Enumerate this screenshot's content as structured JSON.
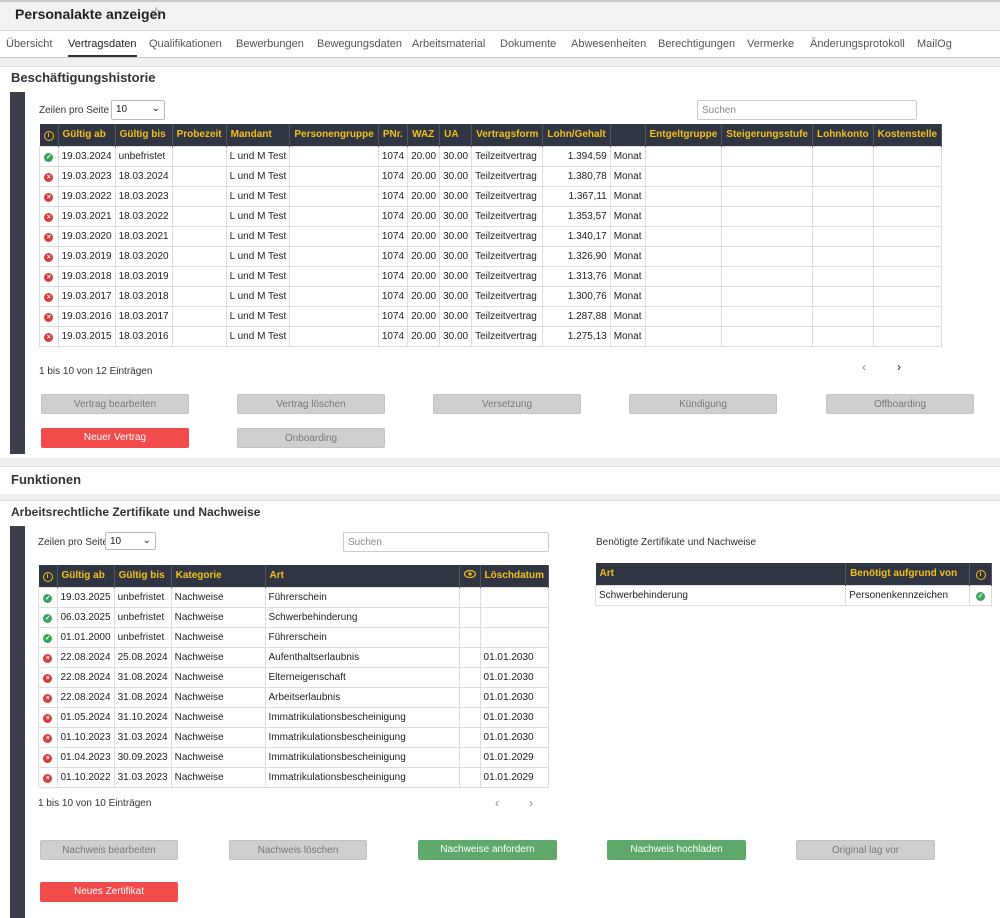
{
  "header": {
    "title": "Personalakte anzeigen"
  },
  "tabs": [
    "Übersicht",
    "Vertragsdaten",
    "Qualifikationen",
    "Bewerbungen",
    "Bewegungsdaten",
    "Arbeitsmaterial",
    "Dokumente",
    "Abwesenheiten",
    "Berechtigungen",
    "Vermerke",
    "Änderungsprotokoll",
    "MailOg"
  ],
  "history": {
    "title": "Beschäftigungshistorie",
    "rows_label": "Zeilen pro Seite",
    "rows_value": "10",
    "search_placeholder": "Suchen",
    "columns": [
      "Gültig ab",
      "Gültig bis",
      "Probezeit",
      "Mandant",
      "Personengruppe",
      "PNr.",
      "WAZ",
      "UA",
      "Vertragsform",
      "Lohn/Gehalt",
      "",
      "Entgeltgruppe",
      "Steigerungsstufe",
      "Lohnkonto",
      "Kostenstelle"
    ],
    "rows": [
      {
        "status": "ok",
        "from": "19.03.2024",
        "to": "unbefristet",
        "probation": "",
        "client": "L und M Test",
        "group": "",
        "pnr": "1074",
        "waz": "20.00",
        "ua": "30.00",
        "form": "Teilzeitvertrag",
        "salary": "1.394,59",
        "unit": "Monat"
      },
      {
        "status": "no",
        "from": "19.03.2023",
        "to": "18.03.2024",
        "probation": "",
        "client": "L und M Test",
        "group": "",
        "pnr": "1074",
        "waz": "20.00",
        "ua": "30.00",
        "form": "Teilzeitvertrag",
        "salary": "1.380,78",
        "unit": "Monat"
      },
      {
        "status": "no",
        "from": "19.03.2022",
        "to": "18.03.2023",
        "probation": "",
        "client": "L und M Test",
        "group": "",
        "pnr": "1074",
        "waz": "20.00",
        "ua": "30.00",
        "form": "Teilzeitvertrag",
        "salary": "1.367,11",
        "unit": "Monat"
      },
      {
        "status": "no",
        "from": "19.03.2021",
        "to": "18.03.2022",
        "probation": "",
        "client": "L und M Test",
        "group": "",
        "pnr": "1074",
        "waz": "20.00",
        "ua": "30.00",
        "form": "Teilzeitvertrag",
        "salary": "1.353,57",
        "unit": "Monat"
      },
      {
        "status": "no",
        "from": "19.03.2020",
        "to": "18.03.2021",
        "probation": "",
        "client": "L und M Test",
        "group": "",
        "pnr": "1074",
        "waz": "20.00",
        "ua": "30.00",
        "form": "Teilzeitvertrag",
        "salary": "1.340,17",
        "unit": "Monat"
      },
      {
        "status": "no",
        "from": "19.03.2019",
        "to": "18.03.2020",
        "probation": "",
        "client": "L und M Test",
        "group": "",
        "pnr": "1074",
        "waz": "20.00",
        "ua": "30.00",
        "form": "Teilzeitvertrag",
        "salary": "1.326,90",
        "unit": "Monat"
      },
      {
        "status": "no",
        "from": "19.03.2018",
        "to": "18.03.2019",
        "probation": "",
        "client": "L und M Test",
        "group": "",
        "pnr": "1074",
        "waz": "20.00",
        "ua": "30.00",
        "form": "Teilzeitvertrag",
        "salary": "1.313,76",
        "unit": "Monat"
      },
      {
        "status": "no",
        "from": "19.03.2017",
        "to": "18.03.2018",
        "probation": "",
        "client": "L und M Test",
        "group": "",
        "pnr": "1074",
        "waz": "20.00",
        "ua": "30.00",
        "form": "Teilzeitvertrag",
        "salary": "1.300,76",
        "unit": "Monat"
      },
      {
        "status": "no",
        "from": "19.03.2016",
        "to": "18.03.2017",
        "probation": "",
        "client": "L und M Test",
        "group": "",
        "pnr": "1074",
        "waz": "20.00",
        "ua": "30.00",
        "form": "Teilzeitvertrag",
        "salary": "1.287,88",
        "unit": "Monat"
      },
      {
        "status": "no",
        "from": "19.03.2015",
        "to": "18.03.2016",
        "probation": "",
        "client": "L und M Test",
        "group": "",
        "pnr": "1074",
        "waz": "20.00",
        "ua": "30.00",
        "form": "Teilzeitvertrag",
        "salary": "1.275,13",
        "unit": "Monat"
      }
    ],
    "info": "1 bis 10 von 12 Einträgen",
    "prev": "‹",
    "next": "›",
    "buttons": {
      "edit": "Vertrag bearbeiten",
      "delete": "Vertrag löschen",
      "transfer": "Versetzung",
      "terminate": "Kündigung",
      "offboarding": "Offboarding",
      "new": "Neuer Vertrag",
      "onboarding": "Onboarding"
    }
  },
  "functions": {
    "title": "Funktionen"
  },
  "certs": {
    "title": "Arbeitsrechtliche Zertifikate und Nachweise",
    "rows_label": "Zeilen pro Seite",
    "rows_value": "10",
    "search_placeholder": "Suchen",
    "columns": [
      "Gültig ab",
      "Gültig bis",
      "Kategorie",
      "Art",
      "Löschdatum"
    ],
    "rows": [
      {
        "status": "ok",
        "from": "19.03.2025",
        "to": "unbefristet",
        "cat": "Nachweise",
        "art": "Führerschein",
        "del": ""
      },
      {
        "status": "ok",
        "from": "06.03.2025",
        "to": "unbefristet",
        "cat": "Nachweise",
        "art": "Schwerbehinderung",
        "del": ""
      },
      {
        "status": "ok",
        "from": "01.01.2000",
        "to": "unbefristet",
        "cat": "Nachweise",
        "art": "Führerschein",
        "del": ""
      },
      {
        "status": "no",
        "from": "22.08.2024",
        "to": "25.08.2024",
        "cat": "Nachweise",
        "art": "Aufenthaltserlaubnis",
        "del": "01.01.2030"
      },
      {
        "status": "no",
        "from": "22.08.2024",
        "to": "31.08.2024",
        "cat": "Nachweise",
        "art": "Elterneigenschaft",
        "del": "01.01.2030"
      },
      {
        "status": "no",
        "from": "22.08.2024",
        "to": "31.08.2024",
        "cat": "Nachweise",
        "art": "Arbeitserlaubnis",
        "del": "01.01.2030"
      },
      {
        "status": "no",
        "from": "01.05.2024",
        "to": "31.10.2024",
        "cat": "Nachweise",
        "art": "Immatrikulationsbescheinigung",
        "del": "01.01.2030"
      },
      {
        "status": "no",
        "from": "01.10.2023",
        "to": "31.03.2024",
        "cat": "Nachweise",
        "art": "Immatrikulationsbescheinigung",
        "del": "01.01.2030"
      },
      {
        "status": "no",
        "from": "01.04.2023",
        "to": "30.09.2023",
        "cat": "Nachweise",
        "art": "Immatrikulationsbescheinigung",
        "del": "01.01.2029"
      },
      {
        "status": "no",
        "from": "01.10.2022",
        "to": "31.03.2023",
        "cat": "Nachweise",
        "art": "Immatrikulationsbescheinigung",
        "del": "01.01.2029"
      }
    ],
    "info": "1 bis 10 von 10 Einträgen",
    "prev": "‹",
    "next": "›",
    "required": {
      "title": "Benötigte Zertifikate und Nachweise",
      "columns": [
        "Art",
        "Benötigt aufgrund von"
      ],
      "rows": [
        {
          "art": "Schwerbehinderung",
          "reason": "Personenkennzeichen",
          "status": "ok"
        }
      ]
    },
    "buttons": {
      "edit": "Nachweis bearbeiten",
      "delete": "Nachweis löschen",
      "request": "Nachweise anfordern",
      "upload": "Nachweis hochladen",
      "original": "Original lag vor",
      "new": "Neues Zertifikat"
    }
  },
  "colors": {
    "header_bg": "#2f3542",
    "header_text": "#f2c01a",
    "ok": "#3aa35a",
    "error": "#d93a3a",
    "primary_red": "#f24b4b",
    "green": "#5ea96a"
  }
}
